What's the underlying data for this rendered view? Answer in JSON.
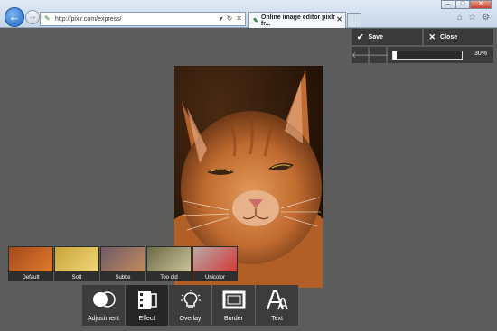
{
  "browser": {
    "url": "http://pixlr.com/express/",
    "tab_title": "Online image editor pixlr fr...",
    "url_controls": [
      "▾",
      "↻",
      "✕"
    ]
  },
  "actions": {
    "save_label": "Save",
    "close_label": "Close"
  },
  "zoom": {
    "value_label": "30%",
    "level": 0.3
  },
  "effects": [
    {
      "label": "Default",
      "color_a": "#a24a1c",
      "color_b": "#e07a2a"
    },
    {
      "label": "Soft",
      "color_a": "#c8a438",
      "color_b": "#f0d77a"
    },
    {
      "label": "Subtle",
      "color_a": "#6e5a68",
      "color_b": "#c28a5c"
    },
    {
      "label": "Too old",
      "color_a": "#6b6a44",
      "color_b": "#cbc39a"
    },
    {
      "label": "Unicolor",
      "color_a": "#b7a9a5",
      "color_b": "#d23a3a"
    }
  ],
  "tools": [
    {
      "label": "Adjustment",
      "icon": "adjustment-icon"
    },
    {
      "label": "Effect",
      "icon": "film-icon"
    },
    {
      "label": "Overlay",
      "icon": "lightbulb-icon"
    },
    {
      "label": "Border",
      "icon": "border-frame-icon"
    },
    {
      "label": "Text",
      "icon": "text-icon"
    }
  ],
  "colors": {
    "workspace": "#5c5c5c",
    "panel": "#3a3a3a",
    "active_tool": "#262626"
  }
}
